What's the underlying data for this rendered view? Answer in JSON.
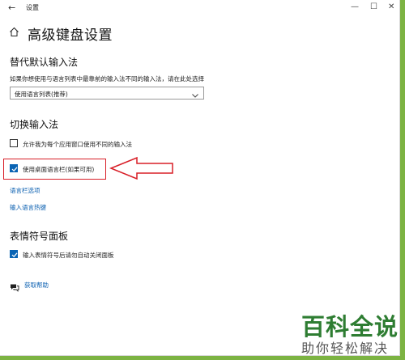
{
  "window": {
    "title": "设置",
    "back_glyph": "←",
    "minimize_glyph": "—",
    "maximize_glyph": "☐",
    "close_glyph": "✕"
  },
  "page": {
    "title": "高级键盘设置"
  },
  "override_section": {
    "heading": "替代默认输入法",
    "description": "如果你想使用与语言列表中最靠前的输入法不同的输入法，请在此处选择",
    "dropdown_value": "使用语言列表(推荐)"
  },
  "switch_section": {
    "heading": "切换输入法",
    "option_per_app": {
      "label": "允许我为每个应用窗口使用不同的输入法",
      "checked": false
    },
    "option_desktop_bar": {
      "label": "使用桌面语言栏(如果可用)",
      "checked": true
    },
    "link_bar_options": "语言栏选项",
    "link_hotkeys": "输入语言热键"
  },
  "emoji_section": {
    "heading": "表情符号面板",
    "option_auto_close": {
      "label": "输入表情符号后请勿自动关闭面板",
      "checked": true
    }
  },
  "help": {
    "link": "获取帮助"
  },
  "watermark": {
    "main": "百科全说",
    "sub": "助你轻松解决"
  },
  "colors": {
    "accent": "#0a64b4",
    "link": "#0a5fb0",
    "annotation_red": "#d81e27",
    "background_green": "#7cb342"
  }
}
